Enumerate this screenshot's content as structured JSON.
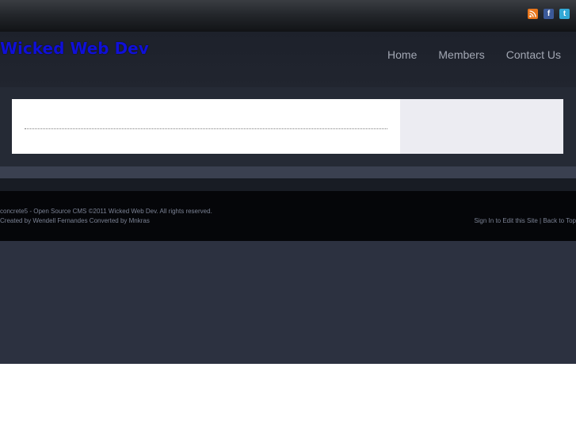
{
  "header": {
    "site_title": "Wicked Web Dev",
    "nav": [
      {
        "label": "Home"
      },
      {
        "label": "Members"
      },
      {
        "label": "Contact Us"
      }
    ]
  },
  "social": [
    {
      "icon": "rss-icon",
      "glyph": "◢",
      "color": "#e8761c"
    },
    {
      "icon": "facebook-icon",
      "glyph": "f",
      "color": "#3b5998"
    },
    {
      "icon": "twitter-icon",
      "glyph": "t",
      "color": "#33a9d6"
    }
  ],
  "footer": {
    "copyright": "concrete5 - Open Source CMS ©2011 Wicked Web Dev. All rights reserved.",
    "credits": "Created by Wendell Fernandes Converted by Mnkras",
    "sign_in": "Sign In to Edit this Site",
    "separator": " | ",
    "back_to_top": "Back to Top"
  },
  "colors": {
    "title": "#1010d8",
    "nav_text": "#a2a7b3",
    "footer_text": "#7b8294"
  }
}
